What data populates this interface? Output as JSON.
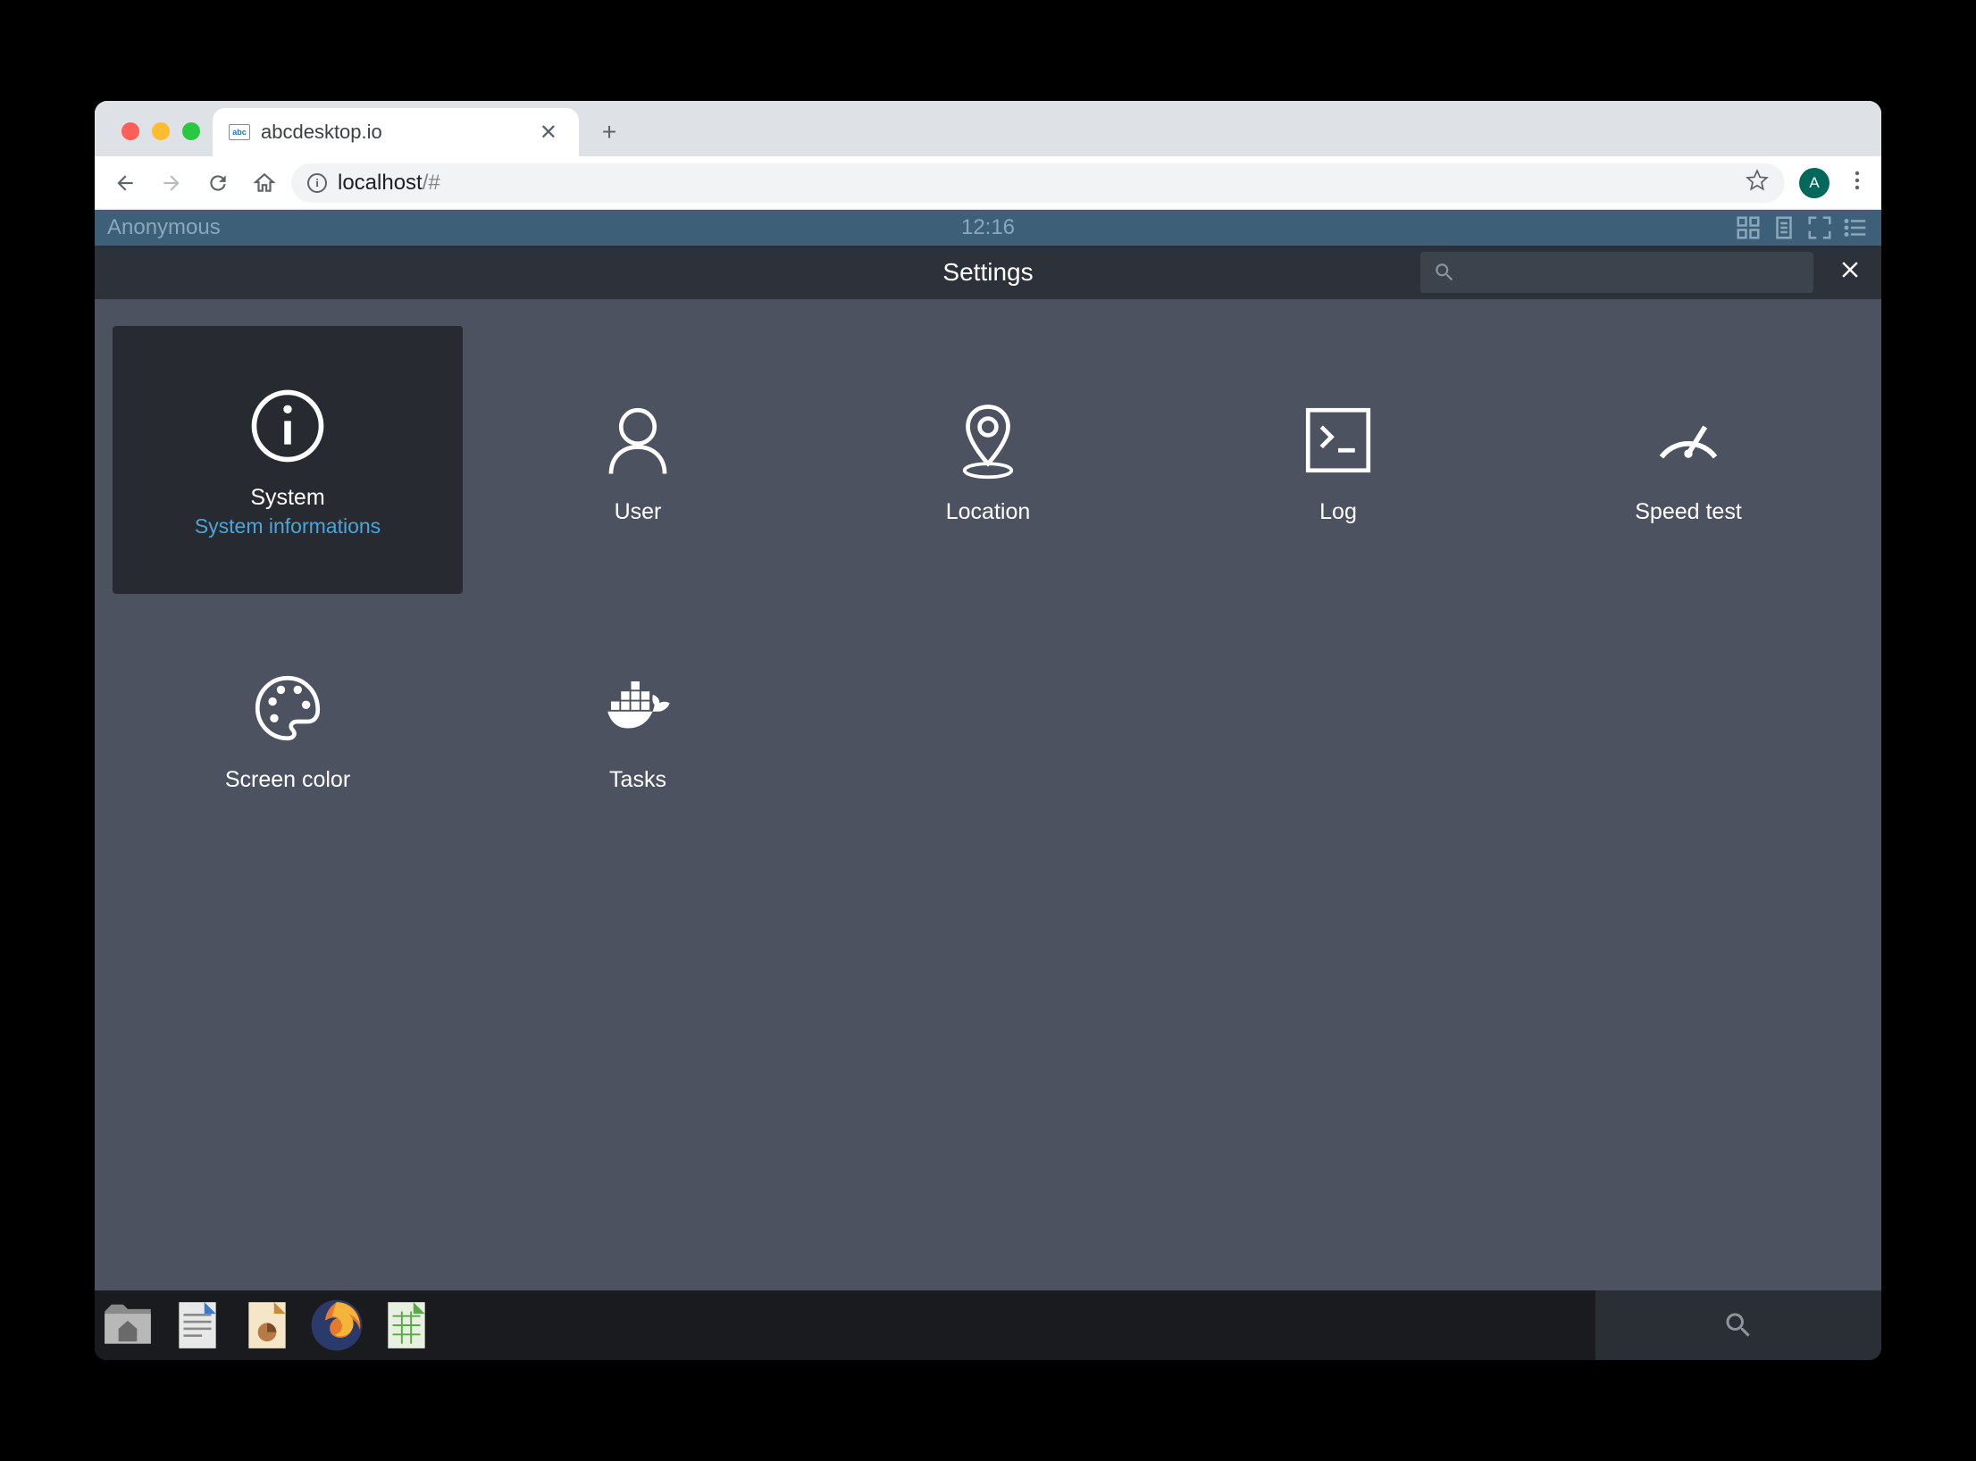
{
  "browser": {
    "tab_title": "abcdesktop.io",
    "url_display": "localhost",
    "url_suffix": "/#",
    "profile_letter": "A"
  },
  "topbar": {
    "user": "Anonymous",
    "time": "12:16"
  },
  "settings_header": {
    "title": "Settings",
    "search_placeholder": ""
  },
  "tiles": [
    {
      "label": "System",
      "sublabel": "System informations",
      "icon": "info",
      "selected": true
    },
    {
      "label": "User",
      "sublabel": "",
      "icon": "user",
      "selected": false
    },
    {
      "label": "Location",
      "sublabel": "",
      "icon": "location",
      "selected": false
    },
    {
      "label": "Log",
      "sublabel": "",
      "icon": "terminal",
      "selected": false
    },
    {
      "label": "Speed test",
      "sublabel": "",
      "icon": "gauge",
      "selected": false
    },
    {
      "label": "Screen color",
      "sublabel": "",
      "icon": "palette",
      "selected": false
    },
    {
      "label": "Tasks",
      "sublabel": "",
      "icon": "docker",
      "selected": false
    }
  ]
}
